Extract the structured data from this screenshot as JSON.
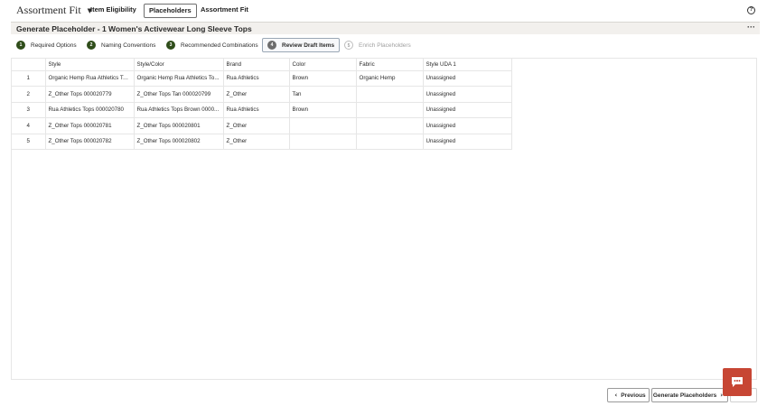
{
  "app": {
    "title": "Assortment Fit"
  },
  "nav": {
    "items": [
      "Item Eligibility",
      "Placeholders",
      "Assortment Fit"
    ],
    "active": "Placeholders"
  },
  "header": {
    "title": "Generate Placeholder - 1 Women's Activewear Long Sleeve Tops"
  },
  "train": [
    {
      "num": "1",
      "label": "Required Options",
      "state": "done"
    },
    {
      "num": "2",
      "label": "Naming Conventions",
      "state": "done"
    },
    {
      "num": "3",
      "label": "Recommended Combinations",
      "state": "done"
    },
    {
      "num": "4",
      "label": "Review Draft Items",
      "state": "current"
    },
    {
      "num": "5",
      "label": "Enrich Placeholders",
      "state": "future"
    }
  ],
  "table": {
    "columns": [
      "",
      "Style",
      "Style/Color",
      "Brand",
      "Color",
      "Fabric",
      "Style UDA 1"
    ],
    "rows": [
      [
        "1",
        "Organic Hemp Rua Athletics To...",
        "Organic Hemp Rua Athletics To...",
        "Rua Athletics",
        "Brown",
        "Organic Hemp",
        "Unassigned"
      ],
      [
        "2",
        "Z_Other Tops 000020779",
        "Z_Other Tops Tan 000020799",
        "Z_Other",
        "Tan",
        "",
        "Unassigned"
      ],
      [
        "3",
        "Rua Athletics Tops 000020780",
        "Rua Athletics Tops Brown 0000...",
        "Rua Athletics",
        "Brown",
        "",
        "Unassigned"
      ],
      [
        "4",
        "Z_Other Tops 000020781",
        "Z_Other Tops 000020801",
        "Z_Other",
        "",
        "",
        "Unassigned"
      ],
      [
        "5",
        "Z_Other Tops 000020782",
        "Z_Other Tops 000020802",
        "Z_Other",
        "",
        "",
        "Unassigned"
      ]
    ]
  },
  "footer": {
    "previous_label": "Previous",
    "generate_label": "Generate Placeholders"
  },
  "colors": {
    "accent_green": "#2f4d1a",
    "chat_red": "#c74634",
    "header_band": "#f2f0ed"
  }
}
